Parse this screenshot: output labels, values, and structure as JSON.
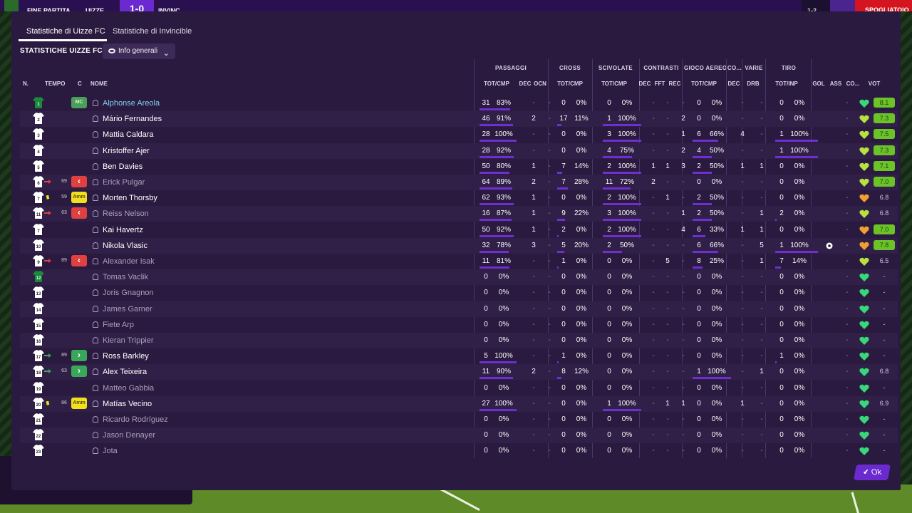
{
  "topbar": {
    "end_label": "FINE PARTITA",
    "home": "UIZZE",
    "score": "1-0",
    "away": "INVINC",
    "right_label": "SPOGLIATOIO",
    "mini_score": "1-2"
  },
  "dialog": {
    "tabs": [
      "Statistiche di Uizze FC",
      "Statistiche di Invincible"
    ],
    "section_title": "STATISTICHE UIZZE FC",
    "dropdown_label": "Info generali",
    "ok_label": "Ok"
  },
  "header": {
    "groups": [
      "PASSAGGI",
      "CROSS",
      "SCIVOLATE",
      "CONTRASTI",
      "GIOCO AEREO",
      "CO...",
      "VARIE",
      "TIRO"
    ],
    "cols": {
      "n": "N.",
      "tempo": "TEMPO",
      "c": "C",
      "nome": "NOME",
      "pass": "TOT/CMP",
      "dec": "DEC",
      "ocn": "OCN",
      "cross": "TOT/CMP",
      "sciv": "TOT/CMP",
      "cdec": "DEC",
      "cfft": "FFT",
      "crec": "REC",
      "aereo": "TOT/CMP",
      "codec": "DEC",
      "drb": "DRB",
      "tiro": "TOT/INP",
      "gol": "GOL",
      "ass": "ASS",
      "co": "CO...",
      "vot": "VOT"
    }
  },
  "players": [
    {
      "num": "1",
      "gk": true,
      "pos": "MC",
      "ev": "",
      "min": "",
      "name": "Alphonse Areola",
      "link": true,
      "active": true,
      "p": [
        "31",
        "83%"
      ],
      "dec": "-",
      "ocn": "-",
      "cr": [
        "0",
        "0%"
      ],
      "sc": [
        "0",
        "0%"
      ],
      "c": [
        "-",
        "-",
        "-"
      ],
      "ae": [
        "0",
        "0%"
      ],
      "codec": "-",
      "drb": "-",
      "ti": [
        "0",
        "0%"
      ],
      "gol": "",
      "ass": "-",
      "heart": "green",
      "vote": "8.1",
      "vote_style": "green"
    },
    {
      "num": "2",
      "gk": false,
      "pos": "",
      "ev": "",
      "min": "",
      "name": "Mário Fernandes",
      "active": true,
      "p": [
        "46",
        "91%"
      ],
      "dec": "2",
      "ocn": "-",
      "cr": [
        "17",
        "11%"
      ],
      "sc": [
        "1",
        "100%"
      ],
      "c": [
        "-",
        "-",
        "2"
      ],
      "ae": [
        "0",
        "0%"
      ],
      "codec": "-",
      "drb": "-",
      "ti": [
        "0",
        "0%"
      ],
      "gol": "",
      "ass": "-",
      "heart": "lime",
      "vote": "7.3",
      "vote_style": "green"
    },
    {
      "num": "3",
      "gk": false,
      "pos": "",
      "ev": "",
      "min": "",
      "name": "Mattia Caldara",
      "active": true,
      "p": [
        "28",
        "100%"
      ],
      "dec": "-",
      "ocn": "-",
      "cr": [
        "0",
        "0%"
      ],
      "sc": [
        "3",
        "100%"
      ],
      "c": [
        "-",
        "-",
        "1"
      ],
      "ae": [
        "6",
        "66%"
      ],
      "codec": "4",
      "drb": "-",
      "ti": [
        "1",
        "100%"
      ],
      "gol": "",
      "ass": "-",
      "heart": "lime",
      "vote": "7.5",
      "vote_style": "green"
    },
    {
      "num": "4",
      "gk": false,
      "pos": "",
      "ev": "",
      "min": "",
      "name": "Kristoffer Ajer",
      "active": true,
      "p": [
        "28",
        "92%"
      ],
      "dec": "-",
      "ocn": "-",
      "cr": [
        "0",
        "0%"
      ],
      "sc": [
        "4",
        "75%"
      ],
      "c": [
        "-",
        "-",
        "2"
      ],
      "ae": [
        "4",
        "50%"
      ],
      "codec": "-",
      "drb": "-",
      "ti": [
        "1",
        "100%"
      ],
      "gol": "",
      "ass": "-",
      "heart": "lime",
      "vote": "7.3",
      "vote_style": "green"
    },
    {
      "num": "5",
      "gk": false,
      "pos": "",
      "ev": "",
      "min": "",
      "name": "Ben Davies",
      "active": true,
      "p": [
        "50",
        "80%"
      ],
      "dec": "1",
      "ocn": "-",
      "cr": [
        "7",
        "14%"
      ],
      "sc": [
        "2",
        "100%"
      ],
      "c": [
        "1",
        "1",
        "3"
      ],
      "ae": [
        "2",
        "50%"
      ],
      "codec": "1",
      "drb": "1",
      "ti": [
        "0",
        "0%"
      ],
      "gol": "",
      "ass": "-",
      "heart": "lime",
      "vote": "7.1",
      "vote_style": "green"
    },
    {
      "num": "6",
      "gk": false,
      "pos": "off",
      "ev": "sub-off",
      "min": "69",
      "name": "Erick Pulgar",
      "active": false,
      "p": [
        "64",
        "89%"
      ],
      "dec": "2",
      "ocn": "-",
      "cr": [
        "7",
        "28%"
      ],
      "sc": [
        "11",
        "72%"
      ],
      "c": [
        "2",
        "-",
        "-"
      ],
      "ae": [
        "0",
        "0%"
      ],
      "codec": "-",
      "drb": "-",
      "ti": [
        "0",
        "0%"
      ],
      "gol": "",
      "ass": "-",
      "heart": "lime",
      "vote": "7.0",
      "vote_style": "green"
    },
    {
      "num": "7",
      "gk": false,
      "pos": "Amm",
      "ev": "yellow",
      "min": "59",
      "name": "Morten Thorsby",
      "active": true,
      "p": [
        "62",
        "93%"
      ],
      "dec": "1",
      "ocn": "-",
      "cr": [
        "0",
        "0%"
      ],
      "sc": [
        "2",
        "100%"
      ],
      "c": [
        "-",
        "1",
        "-"
      ],
      "ae": [
        "2",
        "50%"
      ],
      "codec": "-",
      "drb": "-",
      "ti": [
        "0",
        "0%"
      ],
      "gol": "",
      "ass": "-",
      "heart": "orange",
      "vote": "6.8",
      "vote_style": "plain"
    },
    {
      "num": "11",
      "gk": false,
      "pos": "off",
      "ev": "sub-off",
      "min": "63",
      "name": "Reiss Nelson",
      "active": false,
      "p": [
        "16",
        "87%"
      ],
      "dec": "1",
      "ocn": "-",
      "cr": [
        "9",
        "22%"
      ],
      "sc": [
        "3",
        "100%"
      ],
      "c": [
        "-",
        "-",
        "1"
      ],
      "ae": [
        "2",
        "50%"
      ],
      "codec": "-",
      "drb": "1",
      "ti": [
        "2",
        "0%"
      ],
      "gol": "",
      "ass": "-",
      "heart": "lime",
      "vote": "6.8",
      "vote_style": "plain"
    },
    {
      "num": "7",
      "gk": false,
      "pos": "",
      "ev": "",
      "min": "",
      "name": "Kai Havertz",
      "active": true,
      "p": [
        "50",
        "92%"
      ],
      "dec": "1",
      "ocn": "-",
      "cr": [
        "2",
        "0%"
      ],
      "sc": [
        "2",
        "100%"
      ],
      "c": [
        "-",
        "-",
        "4"
      ],
      "ae": [
        "6",
        "33%"
      ],
      "codec": "1",
      "drb": "1",
      "ti": [
        "0",
        "0%"
      ],
      "gol": "",
      "ass": "-",
      "heart": "orange",
      "vote": "7.0",
      "vote_style": "green"
    },
    {
      "num": "10",
      "gk": false,
      "pos": "",
      "ev": "",
      "min": "",
      "name": "Nikola Vlasic",
      "active": true,
      "p": [
        "32",
        "78%"
      ],
      "dec": "3",
      "ocn": "-",
      "cr": [
        "5",
        "20%"
      ],
      "sc": [
        "2",
        "50%"
      ],
      "c": [
        "-",
        "-",
        "-"
      ],
      "ae": [
        "6",
        "66%"
      ],
      "codec": "-",
      "drb": "5",
      "ti": [
        "1",
        "100%"
      ],
      "gol": "ball",
      "ass": "-",
      "heart": "orange",
      "vote": "7.8",
      "vote_style": "green"
    },
    {
      "num": "9",
      "gk": false,
      "pos": "off",
      "ev": "sub-off",
      "min": "89",
      "name": "Alexander Isak",
      "active": false,
      "p": [
        "11",
        "81%"
      ],
      "dec": "-",
      "ocn": "-",
      "cr": [
        "1",
        "0%"
      ],
      "sc": [
        "0",
        "0%"
      ],
      "c": [
        "-",
        "5",
        "-"
      ],
      "ae": [
        "8",
        "25%"
      ],
      "codec": "-",
      "drb": "1",
      "ti": [
        "7",
        "14%"
      ],
      "gol": "",
      "ass": "-",
      "heart": "lime",
      "vote": "6.5",
      "vote_style": "plain"
    },
    {
      "num": "12",
      "gk": true,
      "pos": "",
      "ev": "",
      "min": "",
      "name": "Tomas Vaclik",
      "active": false,
      "p": [
        "0",
        "0%"
      ],
      "dec": "-",
      "ocn": "-",
      "cr": [
        "0",
        "0%"
      ],
      "sc": [
        "0",
        "0%"
      ],
      "c": [
        "-",
        "-",
        "-"
      ],
      "ae": [
        "0",
        "0%"
      ],
      "codec": "-",
      "drb": "-",
      "ti": [
        "0",
        "0%"
      ],
      "gol": "",
      "ass": "-",
      "heart": "green",
      "vote": "-",
      "vote_style": "plain"
    },
    {
      "num": "13",
      "gk": false,
      "pos": "",
      "ev": "",
      "min": "",
      "name": "Joris Gnagnon",
      "active": false,
      "p": [
        "0",
        "0%"
      ],
      "dec": "-",
      "ocn": "-",
      "cr": [
        "0",
        "0%"
      ],
      "sc": [
        "0",
        "0%"
      ],
      "c": [
        "-",
        "-",
        "-"
      ],
      "ae": [
        "0",
        "0%"
      ],
      "codec": "-",
      "drb": "-",
      "ti": [
        "0",
        "0%"
      ],
      "gol": "",
      "ass": "-",
      "heart": "green",
      "vote": "-",
      "vote_style": "plain"
    },
    {
      "num": "14",
      "gk": false,
      "pos": "",
      "ev": "",
      "min": "",
      "name": "James Garner",
      "active": false,
      "p": [
        "0",
        "0%"
      ],
      "dec": "-",
      "ocn": "-",
      "cr": [
        "0",
        "0%"
      ],
      "sc": [
        "0",
        "0%"
      ],
      "c": [
        "-",
        "-",
        "-"
      ],
      "ae": [
        "0",
        "0%"
      ],
      "codec": "-",
      "drb": "-",
      "ti": [
        "0",
        "0%"
      ],
      "gol": "",
      "ass": "-",
      "heart": "green",
      "vote": "-",
      "vote_style": "plain"
    },
    {
      "num": "15",
      "gk": false,
      "pos": "",
      "ev": "",
      "min": "",
      "name": "Fiete Arp",
      "active": false,
      "p": [
        "0",
        "0%"
      ],
      "dec": "-",
      "ocn": "-",
      "cr": [
        "0",
        "0%"
      ],
      "sc": [
        "0",
        "0%"
      ],
      "c": [
        "-",
        "-",
        "-"
      ],
      "ae": [
        "0",
        "0%"
      ],
      "codec": "-",
      "drb": "-",
      "ti": [
        "0",
        "0%"
      ],
      "gol": "",
      "ass": "-",
      "heart": "green",
      "vote": "-",
      "vote_style": "plain"
    },
    {
      "num": "16",
      "gk": false,
      "pos": "",
      "ev": "",
      "min": "",
      "name": "Kieran Trippier",
      "active": false,
      "p": [
        "0",
        "0%"
      ],
      "dec": "-",
      "ocn": "-",
      "cr": [
        "0",
        "0%"
      ],
      "sc": [
        "0",
        "0%"
      ],
      "c": [
        "-",
        "-",
        "-"
      ],
      "ae": [
        "0",
        "0%"
      ],
      "codec": "-",
      "drb": "-",
      "ti": [
        "0",
        "0%"
      ],
      "gol": "",
      "ass": "-",
      "heart": "green",
      "vote": "-",
      "vote_style": "plain"
    },
    {
      "num": "17",
      "gk": false,
      "pos": "on",
      "ev": "sub-on",
      "min": "89",
      "name": "Ross Barkley",
      "active": true,
      "p": [
        "5",
        "100%"
      ],
      "dec": "-",
      "ocn": "-",
      "cr": [
        "1",
        "0%"
      ],
      "sc": [
        "0",
        "0%"
      ],
      "c": [
        "-",
        "-",
        "-"
      ],
      "ae": [
        "0",
        "0%"
      ],
      "codec": "-",
      "drb": "-",
      "ti": [
        "1",
        "0%"
      ],
      "gol": "",
      "ass": "-",
      "heart": "green",
      "vote": "-",
      "vote_style": "plain"
    },
    {
      "num": "18",
      "gk": false,
      "pos": "on",
      "ev": "sub-on",
      "min": "63",
      "name": "Alex Teixeira",
      "active": true,
      "p": [
        "11",
        "90%"
      ],
      "dec": "2",
      "ocn": "-",
      "cr": [
        "8",
        "12%"
      ],
      "sc": [
        "0",
        "0%"
      ],
      "c": [
        "-",
        "-",
        "-"
      ],
      "ae": [
        "1",
        "100%"
      ],
      "codec": "-",
      "drb": "1",
      "ti": [
        "0",
        "0%"
      ],
      "gol": "",
      "ass": "-",
      "heart": "green",
      "vote": "6.8",
      "vote_style": "plain"
    },
    {
      "num": "19",
      "gk": false,
      "pos": "",
      "ev": "",
      "min": "",
      "name": "Matteo Gabbia",
      "active": false,
      "p": [
        "0",
        "0%"
      ],
      "dec": "-",
      "ocn": "-",
      "cr": [
        "0",
        "0%"
      ],
      "sc": [
        "0",
        "0%"
      ],
      "c": [
        "-",
        "-",
        "-"
      ],
      "ae": [
        "0",
        "0%"
      ],
      "codec": "-",
      "drb": "-",
      "ti": [
        "0",
        "0%"
      ],
      "gol": "",
      "ass": "-",
      "heart": "green",
      "vote": "-",
      "vote_style": "plain"
    },
    {
      "num": "20",
      "gk": false,
      "pos": "Amm",
      "ev": "yellow",
      "min": "86",
      "name": "Matías Vecino",
      "active": true,
      "p": [
        "27",
        "100%"
      ],
      "dec": "-",
      "ocn": "-",
      "cr": [
        "0",
        "0%"
      ],
      "sc": [
        "1",
        "100%"
      ],
      "c": [
        "-",
        "1",
        "1"
      ],
      "ae": [
        "0",
        "0%"
      ],
      "codec": "1",
      "drb": "-",
      "ti": [
        "0",
        "0%"
      ],
      "gol": "",
      "ass": "-",
      "heart": "green",
      "vote": "6.9",
      "vote_style": "plain"
    },
    {
      "num": "21",
      "gk": false,
      "pos": "",
      "ev": "",
      "min": "",
      "name": "Ricardo Rodríguez",
      "active": false,
      "p": [
        "0",
        "0%"
      ],
      "dec": "-",
      "ocn": "-",
      "cr": [
        "0",
        "0%"
      ],
      "sc": [
        "0",
        "0%"
      ],
      "c": [
        "-",
        "-",
        "-"
      ],
      "ae": [
        "0",
        "0%"
      ],
      "codec": "-",
      "drb": "-",
      "ti": [
        "0",
        "0%"
      ],
      "gol": "",
      "ass": "-",
      "heart": "green",
      "vote": "-",
      "vote_style": "plain"
    },
    {
      "num": "22",
      "gk": false,
      "pos": "",
      "ev": "",
      "min": "",
      "name": "Jason Denayer",
      "active": false,
      "p": [
        "0",
        "0%"
      ],
      "dec": "-",
      "ocn": "-",
      "cr": [
        "0",
        "0%"
      ],
      "sc": [
        "0",
        "0%"
      ],
      "c": [
        "-",
        "-",
        "-"
      ],
      "ae": [
        "0",
        "0%"
      ],
      "codec": "-",
      "drb": "-",
      "ti": [
        "0",
        "0%"
      ],
      "gol": "",
      "ass": "-",
      "heart": "green",
      "vote": "-",
      "vote_style": "plain"
    },
    {
      "num": "23",
      "gk": false,
      "pos": "",
      "ev": "",
      "min": "",
      "name": "Jota",
      "active": false,
      "p": [
        "0",
        "0%"
      ],
      "dec": "-",
      "ocn": "-",
      "cr": [
        "0",
        "0%"
      ],
      "sc": [
        "0",
        "0%"
      ],
      "c": [
        "-",
        "-",
        "-"
      ],
      "ae": [
        "0",
        "0%"
      ],
      "codec": "-",
      "drb": "-",
      "ti": [
        "0",
        "0%"
      ],
      "gol": "",
      "ass": "-",
      "heart": "green",
      "vote": "-",
      "vote_style": "plain"
    }
  ],
  "colors": {
    "accent": "#6a2ad0",
    "panel": "#2b1a3f",
    "vote_green": "#6cc328",
    "sub_off": "#e04040",
    "sub_on": "#3aa65a",
    "yellow_card": "#f0e020"
  }
}
